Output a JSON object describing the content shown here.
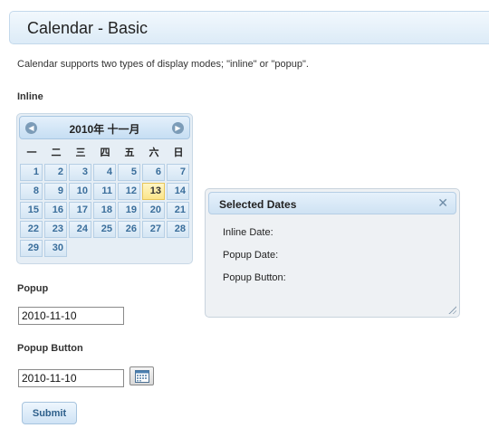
{
  "header": {
    "title": "Calendar - Basic"
  },
  "description": "Calendar supports two types of display modes; \"inline\" or \"popup\".",
  "sections": {
    "inline_label": "Inline",
    "popup_label": "Popup",
    "popup_button_label": "Popup Button"
  },
  "calendar": {
    "title": "2010年 十一月",
    "weekdays": [
      "一",
      "二",
      "三",
      "四",
      "五",
      "六",
      "日"
    ],
    "weeks": [
      [
        "1",
        "2",
        "3",
        "4",
        "5",
        "6",
        "7"
      ],
      [
        "8",
        "9",
        "10",
        "11",
        "12",
        "13",
        "14"
      ],
      [
        "15",
        "16",
        "17",
        "18",
        "19",
        "20",
        "21"
      ],
      [
        "22",
        "23",
        "24",
        "25",
        "26",
        "27",
        "28"
      ],
      [
        "29",
        "30",
        "",
        "",
        "",
        "",
        ""
      ]
    ],
    "highlighted_day": "13"
  },
  "panel": {
    "title": "Selected Dates",
    "inline_date_label": "Inline Date:",
    "popup_date_label": "Popup Date:",
    "popup_button_label": "Popup Button:"
  },
  "inputs": {
    "popup_value": "2010-11-10",
    "popup_button_value": "2010-11-10"
  },
  "buttons": {
    "submit": "Submit"
  },
  "colors": {
    "accent": "#3a6e9b",
    "today_bg": "#fbe58a",
    "header_bg": "#dcebf7"
  }
}
